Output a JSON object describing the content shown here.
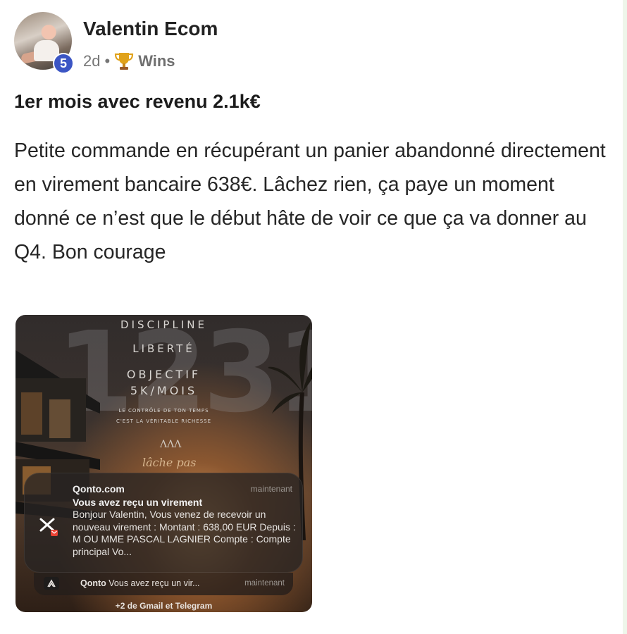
{
  "post": {
    "author": "Valentin Ecom",
    "level": "5",
    "time": "2d",
    "separator": "•",
    "category": "Wins",
    "category_icon": "trophy-icon",
    "title": "1er mois avec revenu 2.1k€",
    "body": "Petite commande en récupérant un panier abandonné directement en virement bancaire 638€. Lâchez rien, ça paye un moment donné ce n’est que le début hâte de voir ce que ça va donner au Q4. Bon courage"
  },
  "image": {
    "big_digits": "1231",
    "lines": [
      "DISCIPLINE",
      "LIBERTÉ",
      "OBJECTIF",
      "5K/MOIS",
      "LE CONTRÔLE DE TON TEMPS",
      "C'EST LA VÉRITABLE RICHESSE"
    ],
    "monogram": "ΛΛΛ",
    "script": "lâche pas",
    "notification": {
      "app": "Qonto.com",
      "time": "maintenant",
      "title": "Vous avez reçu un virement",
      "body": "Bonjour Valentin, Vous venez de recevoir un nouveau virement : Montant : 638,00 EUR Depuis : M OU MME PASCAL LAGNIER Compte : Compte principal Vo..."
    },
    "notification2": {
      "app": "Qonto",
      "text": "Vous avez reçu un vir...",
      "time": "maintenant"
    },
    "more": "+2 de Gmail et Telegram"
  },
  "colors": {
    "badge": "#3b55c4",
    "text": "#262626",
    "meta": "#767676"
  }
}
